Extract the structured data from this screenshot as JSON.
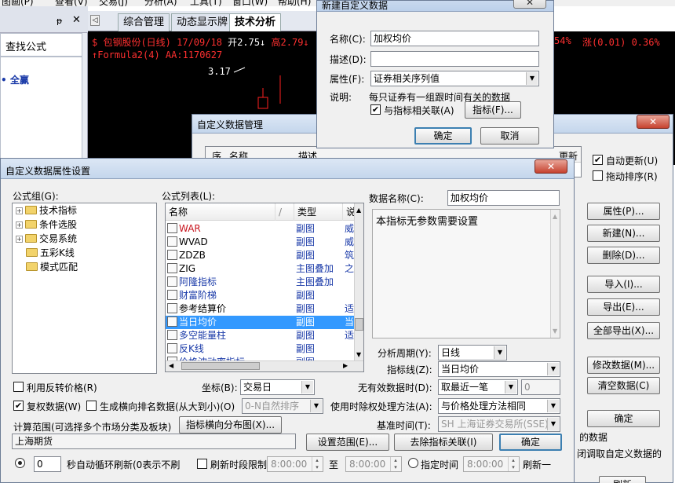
{
  "menu": [
    "图画(P)",
    "查看(V)",
    "交易(J)",
    "分析(A)",
    "工具(T)",
    "窗口(W)",
    "帮助(H)"
  ],
  "left_panel": {
    "pin": "ᵽ",
    "close": "✕",
    "find_formula": "查找公式",
    "item": "全赢"
  },
  "tabs": {
    "nav": "◁",
    "items": [
      "综合管理",
      "动态显示牌",
      "技术分析"
    ]
  },
  "chart": {
    "line1": {
      "stock": "$ 包钢股份(日线) 17/09/18",
      "open": "开2.75↓",
      "high": "高2.79↓",
      "right": "54%",
      "change": "涨(0.01) 0.36%"
    },
    "line2": {
      "formula": "↑Formula2(4) AA:1170627"
    },
    "price_label": "3.17",
    "candle_color": "#ff2020",
    "formula_color": "#ff3030"
  },
  "new_dialog": {
    "title": "新建自定义数据",
    "close": "✕",
    "name_label": "名称(C):",
    "name_value": "加权均价",
    "desc_label": "描述(D):",
    "desc_value": "",
    "attr_label": "属性(F):",
    "attr_value": "证券相关序列值",
    "note_label": "说明:",
    "note_text": "每只证券有一组跟时间有关的数据",
    "link_check": "✔",
    "link_label": "与指标相关联(A)",
    "indicator_btn": "指标(F)...",
    "ok": "确定",
    "cancel": "取消"
  },
  "manage_dialog": {
    "title": "自定义数据管理",
    "close": "✕",
    "col_seq": "序",
    "col_name": "名称",
    "col_desc": "描述",
    "col_update": "更新",
    "auto_update": "自动更新(U)",
    "auto_update_check": "✔",
    "drag_sort": "拖动排序(R)",
    "buttons": [
      "属性(P)...",
      "新建(N)...",
      "删除(D)...",
      "导入(I)...",
      "导出(E)...",
      "全部导出(X)...",
      "修改数据(M)...",
      "清空数据(C)",
      "确定"
    ],
    "text1": "的数据",
    "text2": "闭调取自定义数据的",
    "bottom_label": "刷新"
  },
  "props_dialog": {
    "title": "自定义数据属性设置",
    "close": "✕",
    "group_label": "公式组(G):",
    "tree": [
      {
        "label": "技术指标",
        "expand": "+"
      },
      {
        "label": "条件选股",
        "expand": "+"
      },
      {
        "label": "交易系统",
        "expand": "+"
      },
      {
        "label": "五彩K线",
        "expand": ""
      },
      {
        "label": "模式匹配",
        "expand": ""
      }
    ],
    "list_label": "公式列表(L):",
    "list_headers": [
      "名称",
      "/",
      "类型",
      "说"
    ],
    "formulas": [
      {
        "name": "WAR",
        "type": "副图",
        "desc": "威",
        "color": "red"
      },
      {
        "name": "WVAD",
        "type": "副图",
        "desc": "威",
        "color": ""
      },
      {
        "name": "ZDZB",
        "type": "副图",
        "desc": "筑",
        "color": ""
      },
      {
        "name": "ZIG",
        "type": "主图叠加",
        "desc": "之",
        "color": ""
      },
      {
        "name": "阿隆指标",
        "type": "主图叠加",
        "desc": "",
        "color": "blue"
      },
      {
        "name": "财富阶梯",
        "type": "副图",
        "desc": "",
        "color": "blue"
      },
      {
        "name": "参考结算价",
        "type": "副图",
        "desc": "适",
        "color": ""
      },
      {
        "name": "当日均价",
        "type": "副图",
        "desc": "当",
        "color": "",
        "selected": true
      },
      {
        "name": "多空能量柱",
        "type": "副图",
        "desc": "适",
        "color": "blue"
      },
      {
        "name": "反K线",
        "type": "副图",
        "desc": "",
        "color": "blue"
      },
      {
        "name": "价格波动率指标",
        "type": "副图",
        "desc": "",
        "color": "blue"
      }
    ],
    "data_name_label": "数据名称(C):",
    "data_name_value": "加权均价",
    "param_text": "本指标无参数需要设置",
    "period_label": "分析周期(Y):",
    "period_value": "日线",
    "line_label": "指标线(Z):",
    "line_value": "当日均价",
    "invalid_label": "无有效数据时(D):",
    "invalid_value": "取最近一笔",
    "invalid_num": "0",
    "rev_price": "利用反转价格(R)",
    "coord_label": "坐标(B):",
    "coord_value": "交易日",
    "restore_check": "✔",
    "restore_label": "复权数据(W)",
    "rank_label": "生成横向排名数据(从大到小)(O)",
    "rank_value": "0-N自然排序",
    "timeweight_label": "使用时除权处理方法(A):",
    "timeweight_value": "与价格处理方法相同",
    "calc_label": "计算范围(可选择多个市场分类及板块)",
    "dist_btn": "指标横向分布图(X)...",
    "base_label": "基准时间(T):",
    "base_value": "SH 上海证券交易所(SSE)",
    "market_value": "上海期货",
    "set_range_btn": "设置范围(E)...",
    "unlink_btn": "去除指标关联(I)",
    "ok_btn": "确定",
    "loop_value": "0",
    "loop_label": "秒自动循环刷新(0表示不刷",
    "refresh_limit": "刷新时段限制",
    "time1": "8:00:00",
    "to": "至",
    "time2": "8:00:00",
    "fixed_time": "指定时间",
    "time3": "8:00:00",
    "refresh_one": "刷新一"
  }
}
